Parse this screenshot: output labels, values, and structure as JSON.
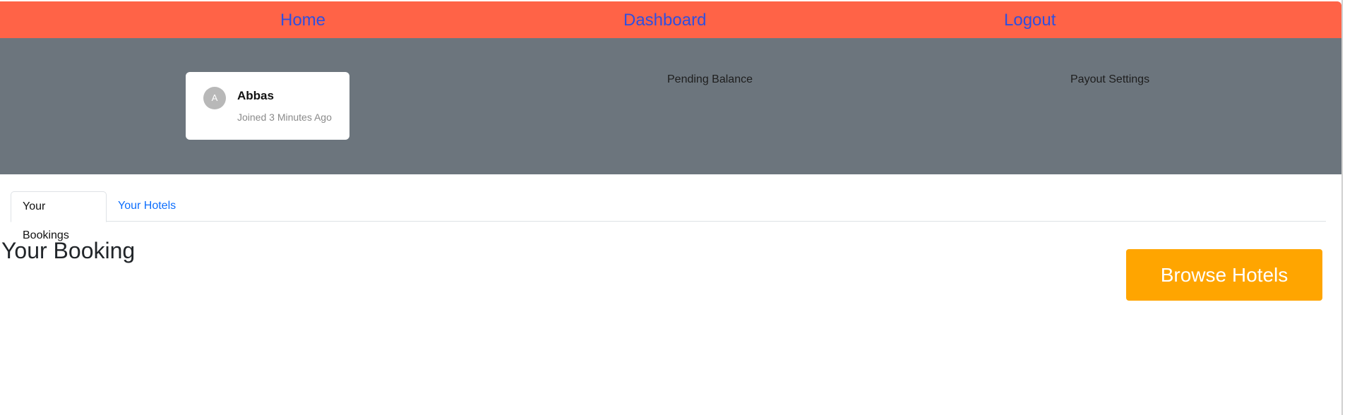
{
  "nav": {
    "home_label": "Home",
    "dashboard_label": "Dashboard",
    "logout_label": "Logout"
  },
  "profile": {
    "avatar_initial": "A",
    "name": "Abbas",
    "joined": "Joined 3 Minutes Ago"
  },
  "stats": {
    "pending_balance_label": "Pending Balance",
    "payout_settings_label": "Payout Settings"
  },
  "tabs": [
    {
      "label": "Your Bookings",
      "active": true
    },
    {
      "label": "Your Hotels",
      "active": false
    }
  ],
  "main": {
    "heading": "Your Booking",
    "browse_button_label": "Browse Hotels"
  },
  "colors": {
    "navbar": "#ff6347",
    "nav_link": "#2f4fe0",
    "hero": "#6c757d",
    "browse_button": "#ffa500",
    "tab_link": "#0d6efd"
  }
}
